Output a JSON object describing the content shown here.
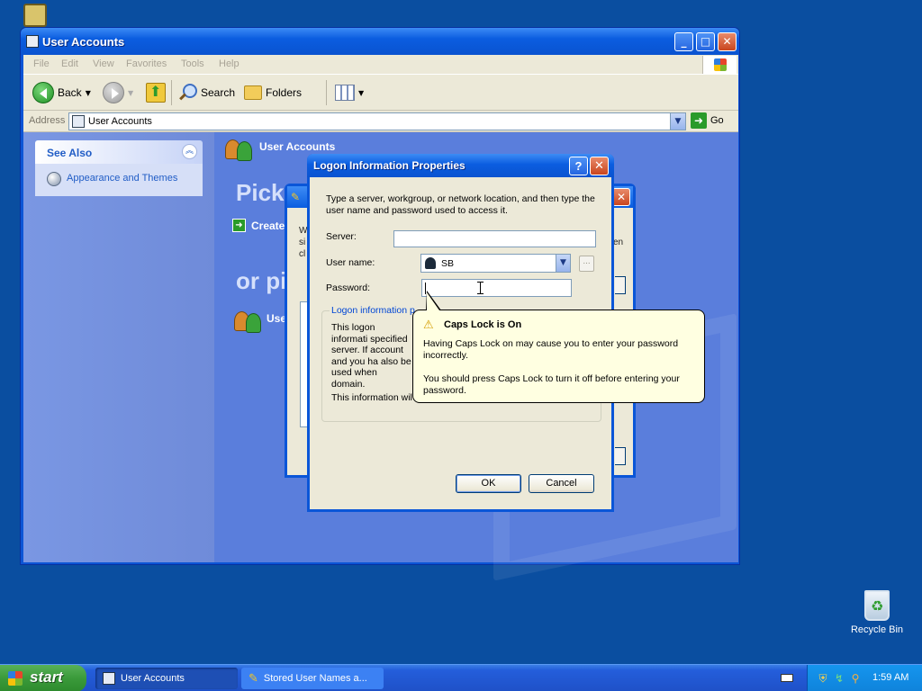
{
  "explorer": {
    "title": "User Accounts",
    "menu": [
      "File",
      "Edit",
      "View",
      "Favorites",
      "Tools",
      "Help"
    ],
    "toolbar": {
      "back": "Back",
      "search": "Search",
      "folders": "Folders"
    },
    "address": {
      "label": "Address",
      "value": "User Accounts",
      "go": "Go"
    },
    "see_also": {
      "header": "See Also",
      "link": "Appearance and Themes"
    },
    "content": {
      "title": "User Accounts",
      "pick": "Pick",
      "or_pick": "or pi",
      "create": "Create",
      "use": "Use"
    }
  },
  "bg_dialog": {
    "frag1": "W",
    "frag2": "si",
    "frag3": "cl",
    "frag4": "en"
  },
  "dialog": {
    "title": "Logon Information Properties",
    "help": "?",
    "instructions": "Type a server, workgroup, or network location, and then type the user name and password used to access it.",
    "server_label": "Server:",
    "server_value": "",
    "username_label": "User name:",
    "username_value": "SB",
    "browse_label": "...",
    "password_label": "Password:",
    "group_title": "Logon information p",
    "group_text": "This logon informati specified server. If account and you ha also be used when domain.",
    "group_footer": "This information wil",
    "ok": "OK",
    "cancel": "Cancel"
  },
  "balloon": {
    "title": "Caps Lock is On",
    "line1": "Having Caps Lock on may cause you to enter your password incorrectly.",
    "line2": "You should press Caps Lock to turn it off before entering your password."
  },
  "desktop": {
    "recycle_bin": "Recycle Bin"
  },
  "taskbar": {
    "start": "start",
    "items": [
      "User Accounts",
      "Stored User Names a..."
    ],
    "clock": "1:59 AM"
  }
}
